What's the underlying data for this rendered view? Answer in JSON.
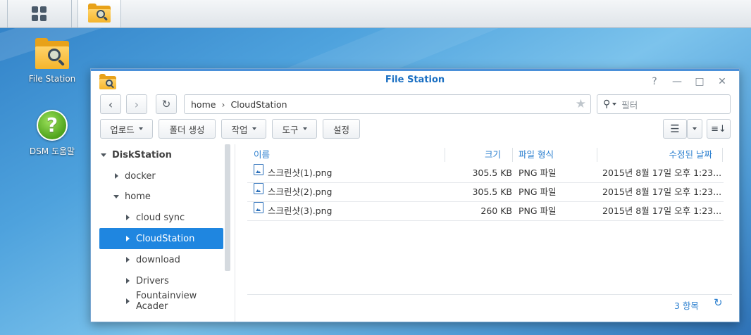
{
  "taskbar": {
    "main_menu_icon": "grid-icon",
    "file_station_icon": "file-station-icon"
  },
  "desktop": {
    "icons": [
      {
        "label": "File Station",
        "icon": "file-station-icon"
      },
      {
        "label": "DSM 도움말",
        "icon": "help-icon"
      }
    ]
  },
  "window": {
    "title": "File Station",
    "controls": {
      "help": "?",
      "minimize": "—",
      "maximize": "□",
      "close": "✕"
    },
    "toolbar": {
      "back_icon": "chevron-left-icon",
      "forward_icon": "chevron-right-icon",
      "refresh_icon": "refresh-icon",
      "upload_label": "업로드",
      "new_folder_label": "폴더 생성",
      "action_label": "작업",
      "tools_label": "도구",
      "settings_label": "설정"
    },
    "address": {
      "segments": [
        "home",
        "CloudStation"
      ],
      "separator": "›"
    },
    "search": {
      "placeholder": "필터"
    },
    "sidebar": {
      "root": "DiskStation",
      "items": [
        {
          "label": "docker",
          "level": 1,
          "expanded": false
        },
        {
          "label": "home",
          "level": 1,
          "expanded": true
        },
        {
          "label": "cloud sync",
          "level": 2,
          "expanded": false
        },
        {
          "label": "CloudStation",
          "level": 2,
          "expanded": false,
          "selected": true
        },
        {
          "label": "download",
          "level": 2,
          "expanded": false
        },
        {
          "label": "Drivers",
          "level": 2,
          "expanded": false
        },
        {
          "label": "Fountainview Acader",
          "level": 2,
          "expanded": false
        }
      ]
    },
    "table": {
      "columns": {
        "name": "이름",
        "size": "크기",
        "type": "파일 형식",
        "modified": "수정된 날짜"
      },
      "rows": [
        {
          "name": "스크린샷(1).png",
          "size": "305.5 KB",
          "type": "PNG 파일",
          "modified": "2015년 8월 17일 오후 1:23..."
        },
        {
          "name": "스크린샷(2).png",
          "size": "305.5 KB",
          "type": "PNG 파일",
          "modified": "2015년 8월 17일 오후 1:23..."
        },
        {
          "name": "스크린샷(3).png",
          "size": "260 KB",
          "type": "PNG 파일",
          "modified": "2015년 8월 17일 오후 1:23..."
        }
      ]
    },
    "footer": {
      "item_count": "3 항목"
    },
    "colors": {
      "accent": "#1f86e0",
      "title": "#1a6fc2"
    }
  }
}
